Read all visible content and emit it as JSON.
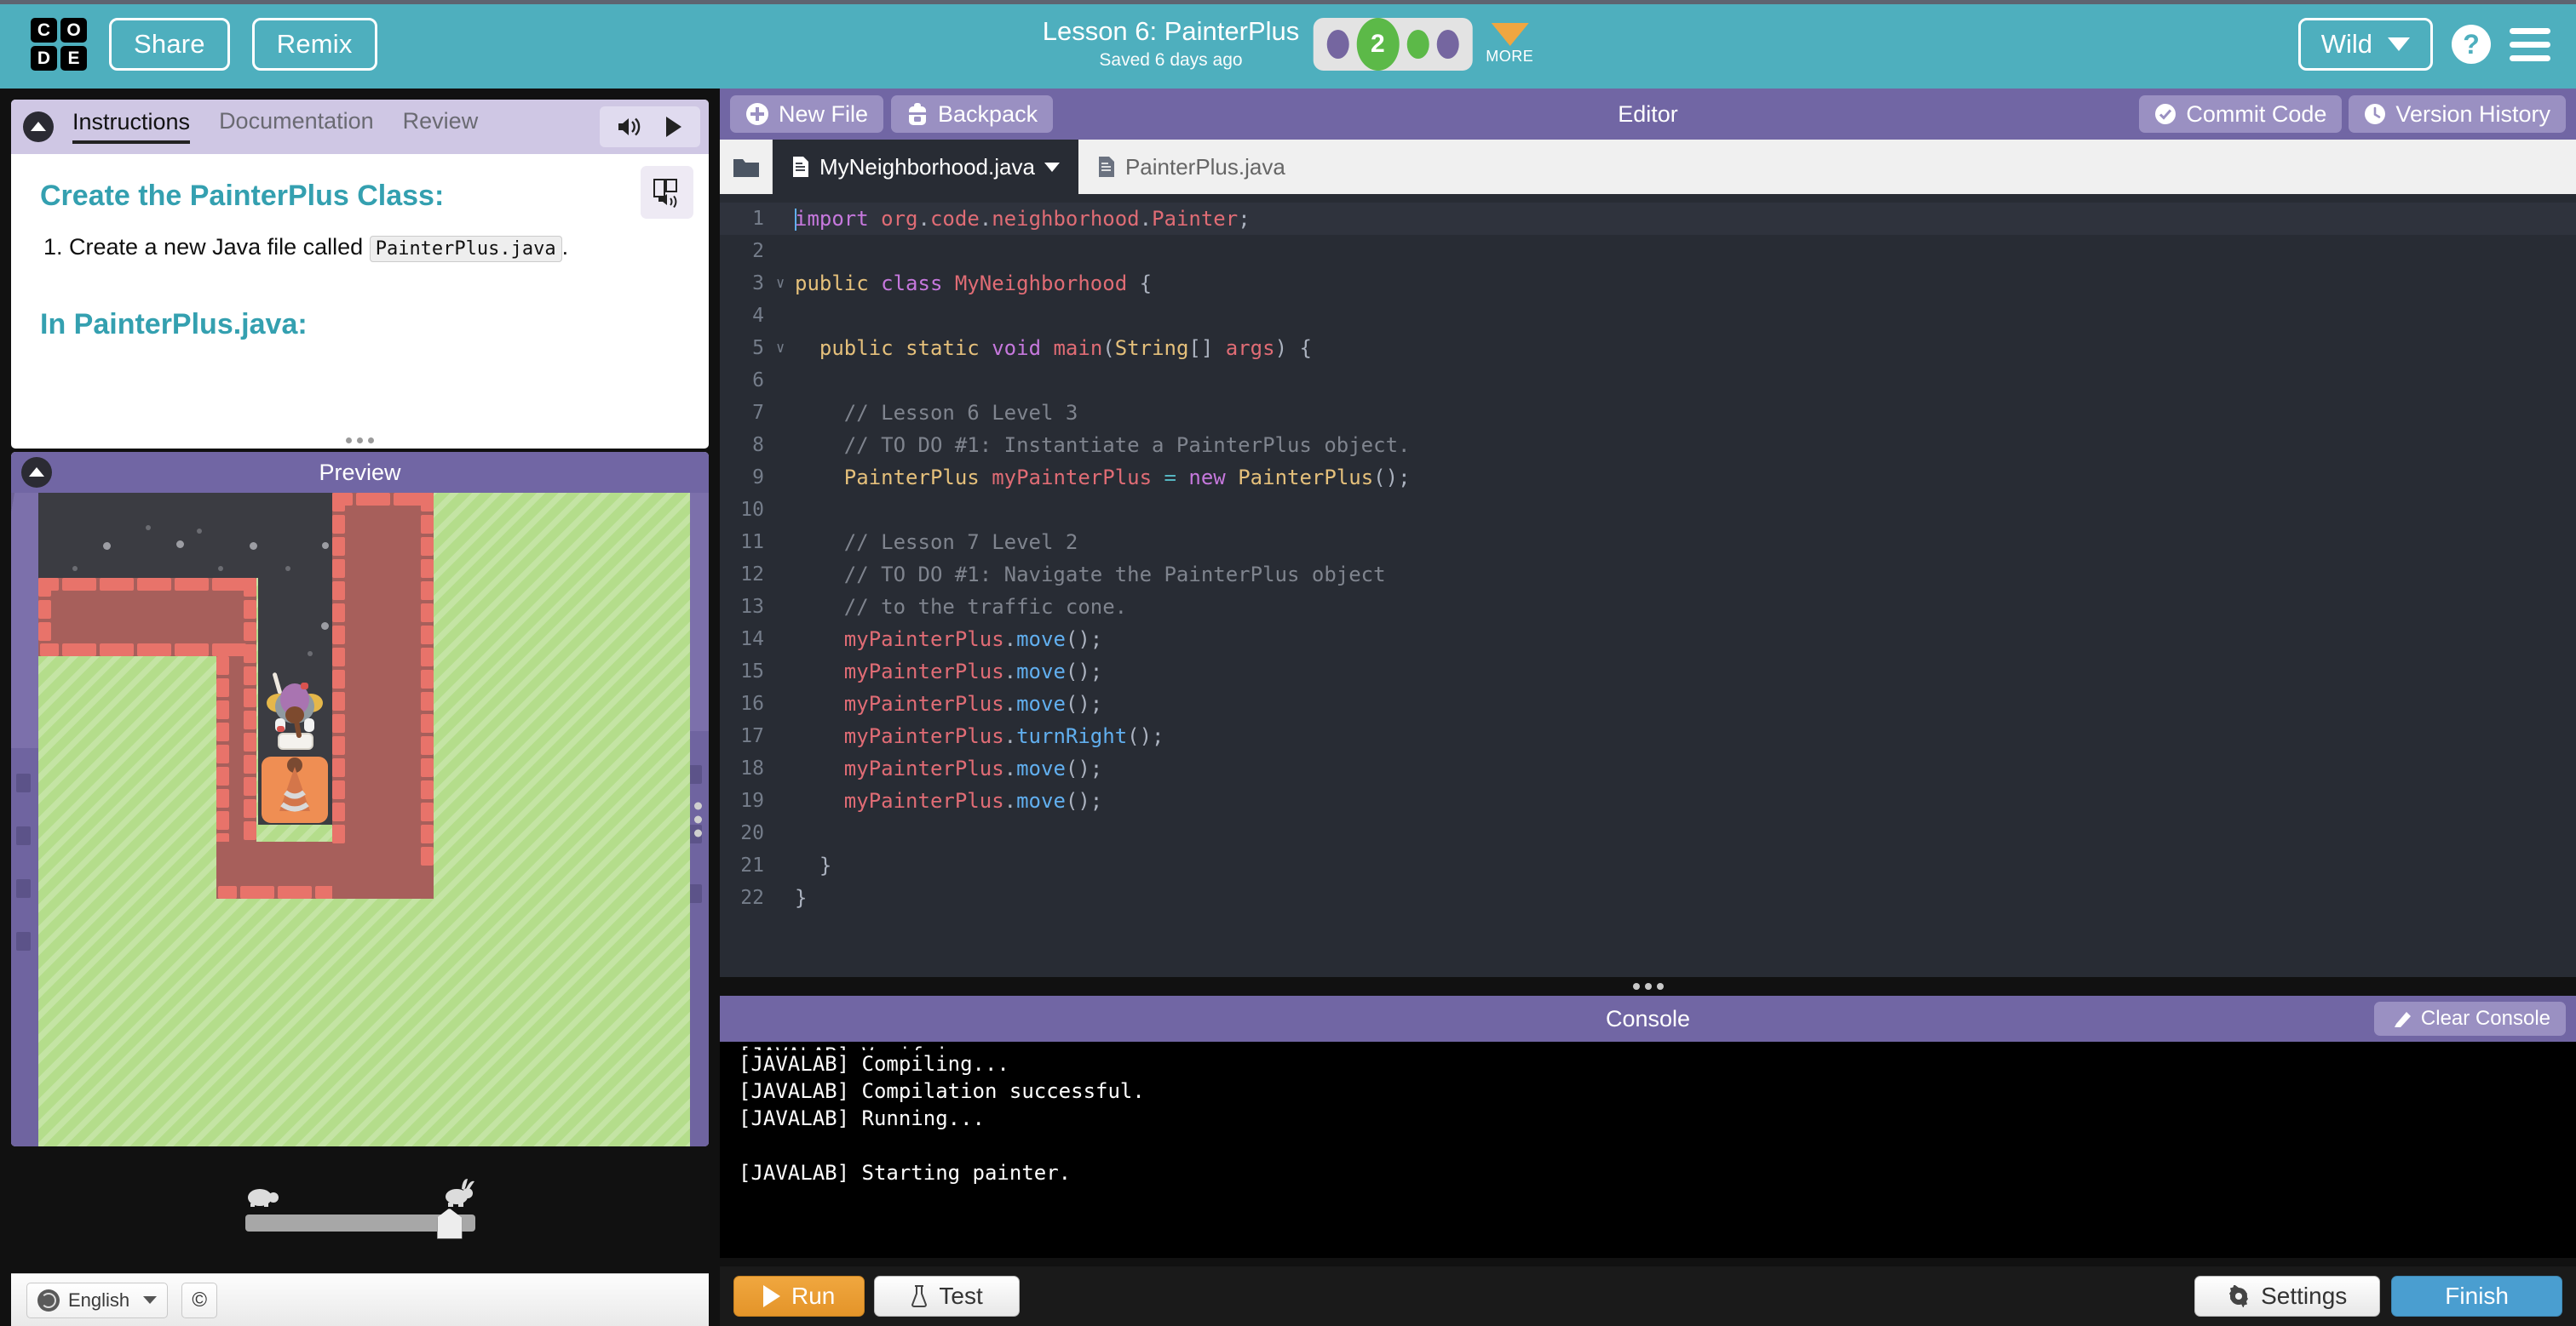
{
  "header": {
    "logo_letters": [
      "C",
      "O",
      "D",
      "E"
    ],
    "share_label": "Share",
    "remix_label": "Remix",
    "lesson_title": "Lesson 6: PainterPlus",
    "saved_status": "Saved 6 days ago",
    "level_bubbles": [
      {
        "label": "",
        "state": "done",
        "color": "#7566a0"
      },
      {
        "label": "2",
        "state": "current",
        "color": "#5cb948"
      },
      {
        "label": "",
        "state": "available",
        "color": "#5cb948"
      },
      {
        "label": "",
        "state": "done",
        "color": "#7566a0"
      }
    ],
    "more_label": "MORE",
    "section_selector": "Wild",
    "help_glyph": "?",
    "accent_color": "#4eafbe"
  },
  "instructions": {
    "tabs": [
      {
        "label": "Instructions",
        "active": true
      },
      {
        "label": "Documentation",
        "active": false
      },
      {
        "label": "Review",
        "active": false
      }
    ],
    "heading_1": "Create the PainterPlus Class:",
    "step_1_prefix": "Create a new Java file called",
    "step_1_code": "PainterPlus.java",
    "step_1_suffix": ".",
    "heading_2": "In PainterPlus.java:",
    "heading_color": "#34a0b0"
  },
  "preview": {
    "title": "Preview",
    "speed_slow_icon": "turtle-icon",
    "speed_fast_icon": "rabbit-icon",
    "speed_value": 83
  },
  "footer": {
    "language": "English",
    "closed_caption": "©"
  },
  "editor": {
    "new_file_label": "New File",
    "backpack_label": "Backpack",
    "panel_label": "Editor",
    "commit_label": "Commit Code",
    "version_history_label": "Version History",
    "file_tabs": [
      {
        "name": "MyNeighborhood.java",
        "active": true,
        "has_menu": true
      },
      {
        "name": "PainterPlus.java",
        "active": false,
        "has_menu": false
      }
    ],
    "lines": [
      {
        "n": 1,
        "fold": "",
        "highlight": true,
        "tokens": [
          {
            "t": "caret",
            "v": ""
          },
          {
            "t": "kw",
            "v": "import"
          },
          {
            "t": "pn",
            "v": " "
          },
          {
            "t": "var",
            "v": "org"
          },
          {
            "t": "pn",
            "v": "."
          },
          {
            "t": "var",
            "v": "code"
          },
          {
            "t": "pn",
            "v": "."
          },
          {
            "t": "var",
            "v": "neighborhood"
          },
          {
            "t": "pn",
            "v": "."
          },
          {
            "t": "var",
            "v": "Painter"
          },
          {
            "t": "pn",
            "v": ";"
          }
        ]
      },
      {
        "n": 2,
        "fold": "",
        "highlight": false,
        "tokens": []
      },
      {
        "n": 3,
        "fold": "v",
        "highlight": false,
        "tokens": [
          {
            "t": "typ",
            "v": "public"
          },
          {
            "t": "pn",
            "v": " "
          },
          {
            "t": "kw",
            "v": "class"
          },
          {
            "t": "pn",
            "v": " "
          },
          {
            "t": "var",
            "v": "MyNeighborhood"
          },
          {
            "t": "pn",
            "v": " {"
          }
        ]
      },
      {
        "n": 4,
        "fold": "",
        "highlight": false,
        "tokens": []
      },
      {
        "n": 5,
        "fold": "v",
        "highlight": false,
        "tokens": [
          {
            "t": "pn",
            "v": "  "
          },
          {
            "t": "typ",
            "v": "public"
          },
          {
            "t": "pn",
            "v": " "
          },
          {
            "t": "typ",
            "v": "static"
          },
          {
            "t": "pn",
            "v": " "
          },
          {
            "t": "kw",
            "v": "void"
          },
          {
            "t": "pn",
            "v": " "
          },
          {
            "t": "var",
            "v": "main"
          },
          {
            "t": "pn",
            "v": "("
          },
          {
            "t": "typ",
            "v": "String"
          },
          {
            "t": "pn",
            "v": "[] "
          },
          {
            "t": "var",
            "v": "args"
          },
          {
            "t": "pn",
            "v": ") {"
          }
        ]
      },
      {
        "n": 6,
        "fold": "",
        "highlight": false,
        "tokens": []
      },
      {
        "n": 7,
        "fold": "",
        "highlight": false,
        "tokens": [
          {
            "t": "cm",
            "v": "    // Lesson 6 Level 3"
          }
        ]
      },
      {
        "n": 8,
        "fold": "",
        "highlight": false,
        "tokens": [
          {
            "t": "cm",
            "v": "    // TO DO #1: Instantiate a PainterPlus object."
          }
        ]
      },
      {
        "n": 9,
        "fold": "",
        "highlight": false,
        "tokens": [
          {
            "t": "pn",
            "v": "    "
          },
          {
            "t": "typ",
            "v": "PainterPlus"
          },
          {
            "t": "pn",
            "v": " "
          },
          {
            "t": "var",
            "v": "myPainterPlus"
          },
          {
            "t": "pn",
            "v": " "
          },
          {
            "t": "op",
            "v": "="
          },
          {
            "t": "pn",
            "v": " "
          },
          {
            "t": "kw",
            "v": "new"
          },
          {
            "t": "pn",
            "v": " "
          },
          {
            "t": "typ",
            "v": "PainterPlus"
          },
          {
            "t": "pn",
            "v": "();"
          }
        ]
      },
      {
        "n": 10,
        "fold": "",
        "highlight": false,
        "tokens": []
      },
      {
        "n": 11,
        "fold": "",
        "highlight": false,
        "tokens": [
          {
            "t": "cm",
            "v": "    // Lesson 7 Level 2"
          }
        ]
      },
      {
        "n": 12,
        "fold": "",
        "highlight": false,
        "tokens": [
          {
            "t": "cm",
            "v": "    // TO DO #1: Navigate the PainterPlus object"
          }
        ]
      },
      {
        "n": 13,
        "fold": "",
        "highlight": false,
        "tokens": [
          {
            "t": "cm",
            "v": "    // to the traffic cone."
          }
        ]
      },
      {
        "n": 14,
        "fold": "",
        "highlight": false,
        "tokens": [
          {
            "t": "pn",
            "v": "    "
          },
          {
            "t": "var",
            "v": "myPainterPlus"
          },
          {
            "t": "pn",
            "v": "."
          },
          {
            "t": "fn",
            "v": "move"
          },
          {
            "t": "pn",
            "v": "();"
          }
        ]
      },
      {
        "n": 15,
        "fold": "",
        "highlight": false,
        "tokens": [
          {
            "t": "pn",
            "v": "    "
          },
          {
            "t": "var",
            "v": "myPainterPlus"
          },
          {
            "t": "pn",
            "v": "."
          },
          {
            "t": "fn",
            "v": "move"
          },
          {
            "t": "pn",
            "v": "();"
          }
        ]
      },
      {
        "n": 16,
        "fold": "",
        "highlight": false,
        "tokens": [
          {
            "t": "pn",
            "v": "    "
          },
          {
            "t": "var",
            "v": "myPainterPlus"
          },
          {
            "t": "pn",
            "v": "."
          },
          {
            "t": "fn",
            "v": "move"
          },
          {
            "t": "pn",
            "v": "();"
          }
        ]
      },
      {
        "n": 17,
        "fold": "",
        "highlight": false,
        "tokens": [
          {
            "t": "pn",
            "v": "    "
          },
          {
            "t": "var",
            "v": "myPainterPlus"
          },
          {
            "t": "pn",
            "v": "."
          },
          {
            "t": "fn",
            "v": "turnRight"
          },
          {
            "t": "pn",
            "v": "();"
          }
        ]
      },
      {
        "n": 18,
        "fold": "",
        "highlight": false,
        "tokens": [
          {
            "t": "pn",
            "v": "    "
          },
          {
            "t": "var",
            "v": "myPainterPlus"
          },
          {
            "t": "pn",
            "v": "."
          },
          {
            "t": "fn",
            "v": "move"
          },
          {
            "t": "pn",
            "v": "();"
          }
        ]
      },
      {
        "n": 19,
        "fold": "",
        "highlight": false,
        "tokens": [
          {
            "t": "pn",
            "v": "    "
          },
          {
            "t": "var",
            "v": "myPainterPlus"
          },
          {
            "t": "pn",
            "v": "."
          },
          {
            "t": "fn",
            "v": "move"
          },
          {
            "t": "pn",
            "v": "();"
          }
        ]
      },
      {
        "n": 20,
        "fold": "",
        "highlight": false,
        "tokens": []
      },
      {
        "n": 21,
        "fold": "",
        "highlight": false,
        "tokens": [
          {
            "t": "pn",
            "v": "  }"
          }
        ]
      },
      {
        "n": 22,
        "fold": "",
        "highlight": false,
        "tokens": [
          {
            "t": "pn",
            "v": "}"
          }
        ]
      }
    ]
  },
  "console": {
    "title": "Console",
    "clear_label": "Clear Console",
    "lines": [
      "[JAVALAB] Compiling...",
      "[JAVALAB] Compilation successful.",
      "[JAVALAB] Running...",
      "",
      "[JAVALAB] Starting painter."
    ]
  },
  "bottom_bar": {
    "run_label": "Run",
    "test_label": "Test",
    "settings_label": "Settings",
    "finish_label": "Finish",
    "run_color": "#e8a13a",
    "finish_color": "#4a9ed0"
  }
}
